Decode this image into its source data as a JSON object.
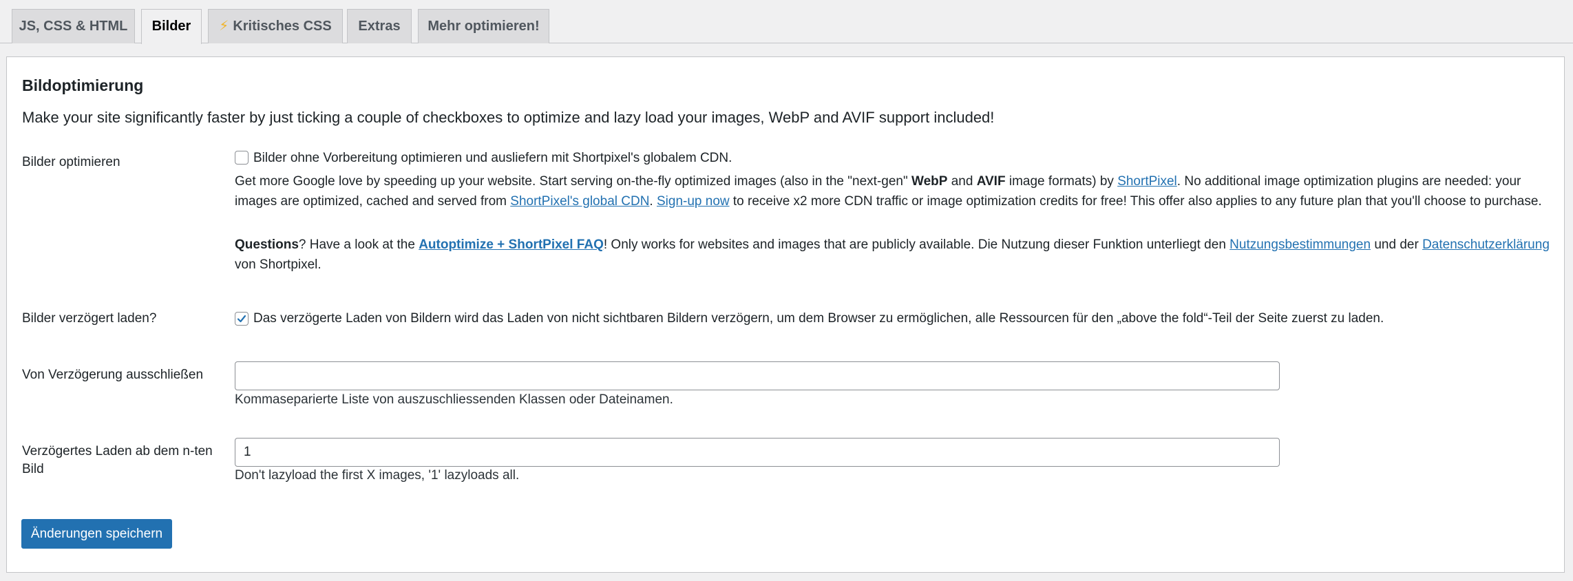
{
  "tabs": [
    {
      "label": "JS, CSS & HTML"
    },
    {
      "label": "Bilder"
    },
    {
      "label": "Kritisches CSS"
    },
    {
      "label": "Extras"
    },
    {
      "label": "Mehr optimieren!"
    }
  ],
  "section": {
    "title": "Bildoptimierung",
    "intro": "Make your site significantly faster by just ticking a couple of checkboxes to optimize and lazy load your images, WebP and AVIF support included!"
  },
  "optimize": {
    "label": "Bilder optimieren",
    "checkbox_label": "Bilder ohne Vorbereitung optimieren und ausliefern mit Shortpixel's globalem CDN.",
    "checked": false,
    "desc1_a": "Get more Google love by speeding up your website. Start serving on-the-fly optimized images (also in the \"next-gen\" ",
    "desc1_webp": "WebP",
    "desc1_and": " and ",
    "desc1_avif": "AVIF",
    "desc1_b": " image formats) by ",
    "desc1_link1": "ShortPixel",
    "desc1_c": ". No additional image optimization plugins are needed: your images are optimized, cached and served from ",
    "desc1_link2": "ShortPixel's global CDN",
    "desc1_d": ". ",
    "desc1_link3": "Sign-up now",
    "desc1_e": " to receive x2 more CDN traffic or image optimization credits for free! This offer also applies to any future plan that you'll choose to purchase.",
    "desc2_q": "Questions",
    "desc2_a": "? Have a look at the ",
    "desc2_link1": "Autoptimize + ShortPixel FAQ",
    "desc2_b": "! Only works for websites and images that are publicly available. Die Nutzung dieser Funktion unterliegt den ",
    "desc2_link2": "Nutzungsbestimmungen",
    "desc2_c": " und der ",
    "desc2_link3": "Datenschutzerklärung",
    "desc2_d": " von Shortpixel."
  },
  "lazyload": {
    "label": "Bilder verzögert laden?",
    "checkbox_label": "Das verzögerte Laden von Bildern wird das Laden von nicht sichtbaren Bildern verzögern, um dem Browser zu ermöglichen, alle Ressourcen für den „above the fold“-Teil der Seite zuerst zu laden.",
    "checked": true
  },
  "exclude": {
    "label": "Von Verzögerung ausschließen",
    "value": "",
    "hint": "Kommaseparierte Liste von auszuschliessenden Klassen oder Dateinamen."
  },
  "lazy_from": {
    "label": "Verzögertes Laden ab dem n-ten Bild",
    "value": "1",
    "hint": "Don't lazyload the first X images, '1' lazyloads all."
  },
  "save_label": "Änderungen speichern",
  "colors": {
    "accent": "#2271b1",
    "bolt": "#f0b429"
  }
}
